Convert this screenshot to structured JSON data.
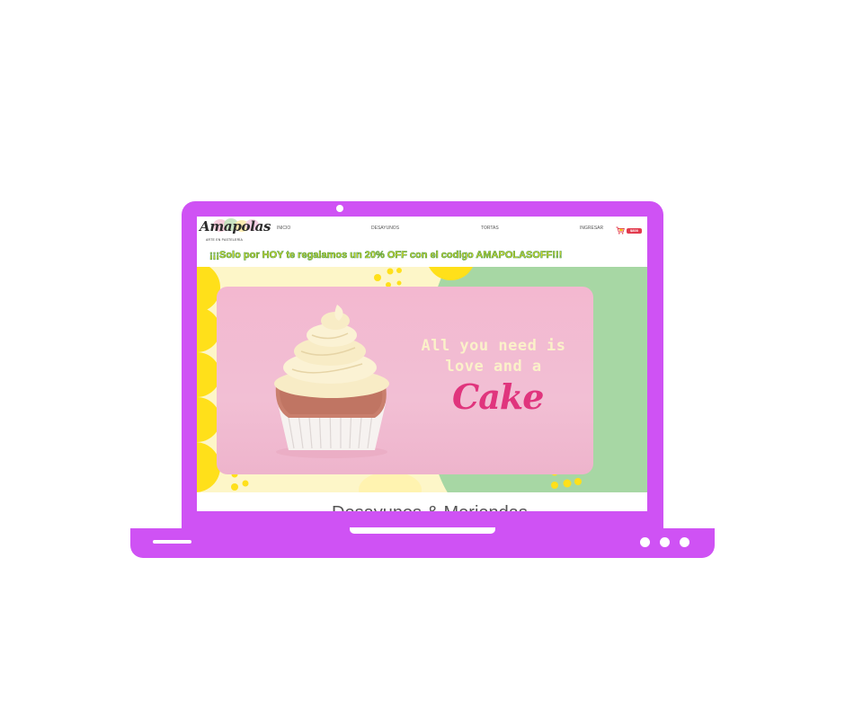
{
  "brand": {
    "logo_text": "Amapolas",
    "logo_subtitle": "ARTE EN PASTELERÍA"
  },
  "nav": {
    "items": [
      {
        "label": "INICIO"
      },
      {
        "label": "DESAYUNOS"
      },
      {
        "label": "TORTAS"
      },
      {
        "label": "INGRESAR"
      }
    ],
    "cart_badge": "$800"
  },
  "promo_text": "¡¡¡Solo por HOY te regalamos un 20% OFF con el codigo AMAPOLASOFF!!!",
  "hero": {
    "tagline_line1": "All you need is",
    "tagline_line2": "love and a",
    "cake_word": "Cake"
  },
  "section_title": "Desayunos & Meriendas",
  "colors": {
    "laptop": "#cf52f4",
    "hero_pink": "#f2bfd4",
    "hero_green": "#a7d7a4",
    "hero_yellow": "#ffe01a",
    "hero_cream": "#fdf6c8",
    "cake_pink": "#e0357d",
    "promo_fill": "#d9dd2a",
    "promo_outline": "#4d9a46",
    "cart_badge": "#e23b4e"
  },
  "icons": {
    "cart": "shopping-cart-icon",
    "camera": "webcam-dot"
  }
}
